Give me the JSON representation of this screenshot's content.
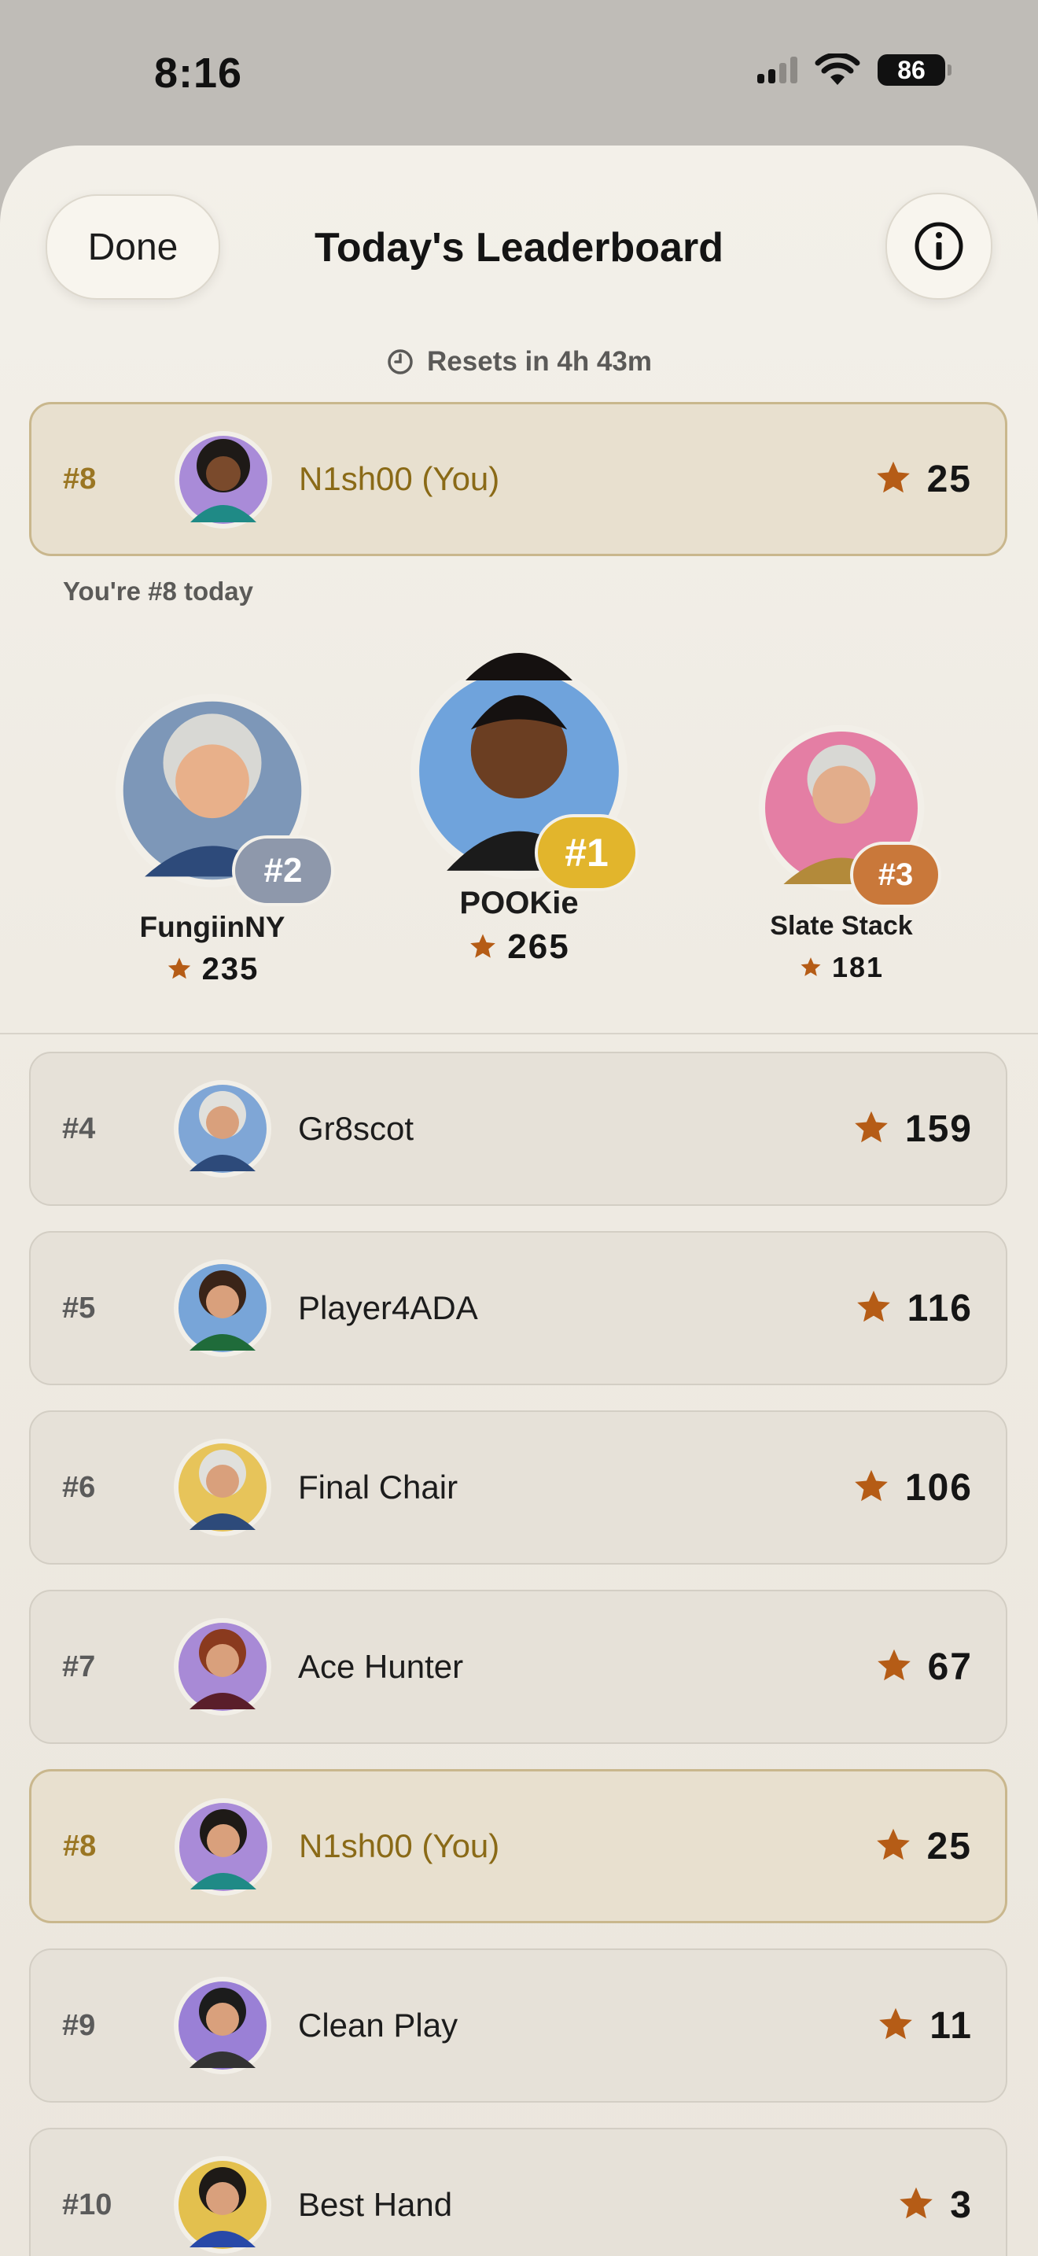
{
  "status_bar": {
    "time": "8:16",
    "battery": "86"
  },
  "header": {
    "done_label": "Done",
    "title": "Today's Leaderboard",
    "info_icon": "info-icon"
  },
  "reset": {
    "icon": "clock-icon",
    "text": "Resets in 4h 43m"
  },
  "current_user": {
    "rank": "#8",
    "name": "N1sh00 (You)",
    "score": "25",
    "note": "You're #8 today"
  },
  "podium": [
    {
      "rank": "#1",
      "name": "POOKie",
      "score": "265",
      "badge_color": "#e2b52c",
      "avatar_bg": "#6fa3dc"
    },
    {
      "rank": "#2",
      "name": "FungiinNY",
      "score": "235",
      "badge_color": "#8e98ab",
      "avatar_bg": "#7d97b8"
    },
    {
      "rank": "#3",
      "name": "Slate Stack",
      "score": "181",
      "badge_color": "#c9783a",
      "avatar_bg": "#e47ea4"
    }
  ],
  "list": [
    {
      "rank": "#4",
      "name": "Gr8scot",
      "score": "159",
      "avatar_bg": "#7fa6d6",
      "you": false
    },
    {
      "rank": "#5",
      "name": "Player4ADA",
      "score": "116",
      "avatar_bg": "#78a5d8",
      "you": false
    },
    {
      "rank": "#6",
      "name": "Final Chair",
      "score": "106",
      "avatar_bg": "#e7c45a",
      "you": false
    },
    {
      "rank": "#7",
      "name": "Ace Hunter",
      "score": "67",
      "avatar_bg": "#a88ad6",
      "you": false
    },
    {
      "rank": "#8",
      "name": "N1sh00 (You)",
      "score": "25",
      "avatar_bg": "#a98bd8",
      "you": true
    },
    {
      "rank": "#9",
      "name": "Clean Play",
      "score": "11",
      "avatar_bg": "#9a80d6",
      "you": false
    },
    {
      "rank": "#10",
      "name": "Best Hand",
      "score": "3",
      "avatar_bg": "#e3c04e",
      "you": false
    }
  ],
  "colors": {
    "star": "#b55c16",
    "you_text": "#8a6a17",
    "you_border": "#c9b78d"
  }
}
